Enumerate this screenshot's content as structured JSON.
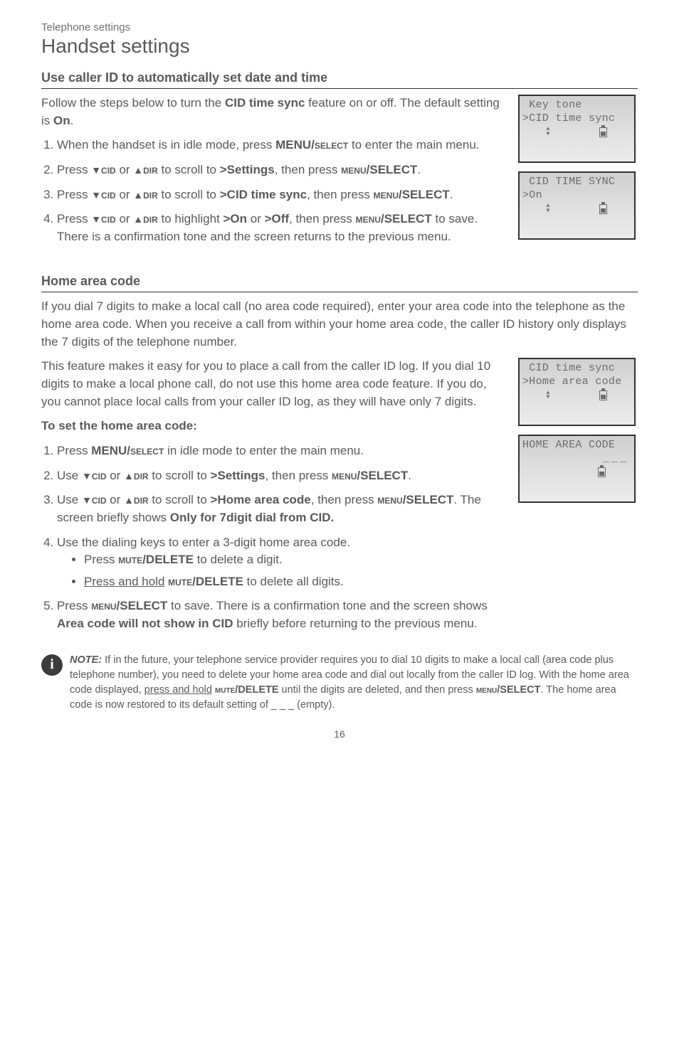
{
  "breadcrumb": "Telephone settings",
  "section_title": "Handset settings",
  "sub1": {
    "heading": "Use caller ID to automatically set date and time",
    "intro_a": "Follow the steps below to turn the ",
    "intro_bold": "CID time sync",
    "intro_b": " feature on or off. The default setting is ",
    "intro_on": "On",
    "intro_c": ".",
    "step1_a": "When the handset is in idle mode, press ",
    "step1_bold": "MENU/",
    "step1_sc": "select",
    "step1_b": " to enter the main menu.",
    "step2_a": "Press ",
    "step2_cid": "cid",
    "step2_or": " or ",
    "step2_dir": "dir",
    "step2_b": " to scroll to ",
    "step2_settings": ">Settings",
    "step2_c": ", then press ",
    "step2_menu_sc": "menu",
    "step2_select": "/SELECT",
    "step2_d": ".",
    "step3_a": "Press ",
    "step3_b": " to scroll to ",
    "step3_cid": ">CID time sync",
    "step3_c": ", then press ",
    "step3_d": ".",
    "step4_a": "Press ",
    "step4_b": " to highlight ",
    "step4_on": ">On",
    "step4_or": " or ",
    "step4_off": ">Off",
    "step4_c": ", then press ",
    "step4_d": " to save. There is a confirmation tone and the screen returns to the previous menu."
  },
  "screens": {
    "s1_l1": " Key tone",
    "s1_l2": ">CID time sync",
    "s2_l1": " CID TIME SYNC",
    "s2_l2": ">On",
    "s3_l1": " CID time sync",
    "s3_l2": ">Home area code",
    "s4_l1": "HOME AREA CODE",
    "s4_val": "___"
  },
  "sub2": {
    "heading": "Home area code",
    "para1": "If you dial 7 digits to make a local call (no area code required), enter your area code into the telephone as the home area code. When you receive a call from within your home area code, the caller ID history only displays the 7 digits of the telephone number.",
    "para2": "This feature makes it easy for you to place a call from the caller ID log. If you dial 10 digits to make a local phone call, do not use this home area code feature. If you do, you cannot place local calls from your caller ID log, as they will have only 7 digits.",
    "toset": "To set the home area code:",
    "b1_a": "Press ",
    "b1_bold": "MENU/",
    "b1_sc": "select",
    "b1_b": " in idle mode to enter the main menu.",
    "b2_a": "Use ",
    "b2_b": " to scroll to ",
    "b2_settings": ">Settings",
    "b2_c": ", then press ",
    "b2_d": ".",
    "b3_a": "Use ",
    "b3_b": " to scroll to ",
    "b3_hac": ">Home area code",
    "b3_c": ", then press ",
    "b3_d": ". The screen briefly shows ",
    "b3_only": "Only for 7digit dial from CID.",
    "b4": "Use the dialing keys to enter a 3-digit home area code.",
    "b4_1a": "Press ",
    "b4_1sc": "mute",
    "b4_1del": "/DELETE",
    "b4_1b": " to delete a digit.",
    "b4_2a": "Press and hold",
    "b4_2b": " to delete all digits.",
    "b5_a": "Press ",
    "b5_b": " to save. There is a confirmation tone and the screen shows ",
    "b5_msg": "Area code will not show in CID",
    "b5_c": " briefly before returning to the previous menu."
  },
  "note": {
    "lead": "NOTE:",
    "a": " If in the future, your telephone service provider requires you to dial 10 digits to make a local call (area code plus telephone number), you need to delete your home area code and dial out locally from the caller ID log. With the home area code displayed, ",
    "u": "press and hold",
    "sp": " ",
    "mute_sc": "mute",
    "del": "/DELETE",
    "b": " until the digits are deleted, and then press ",
    "menu_sc": "menu",
    "sel": "/SELECT",
    "c": ". The home area code is now restored to its default setting of _ _ _ (empty)."
  },
  "page": "16"
}
